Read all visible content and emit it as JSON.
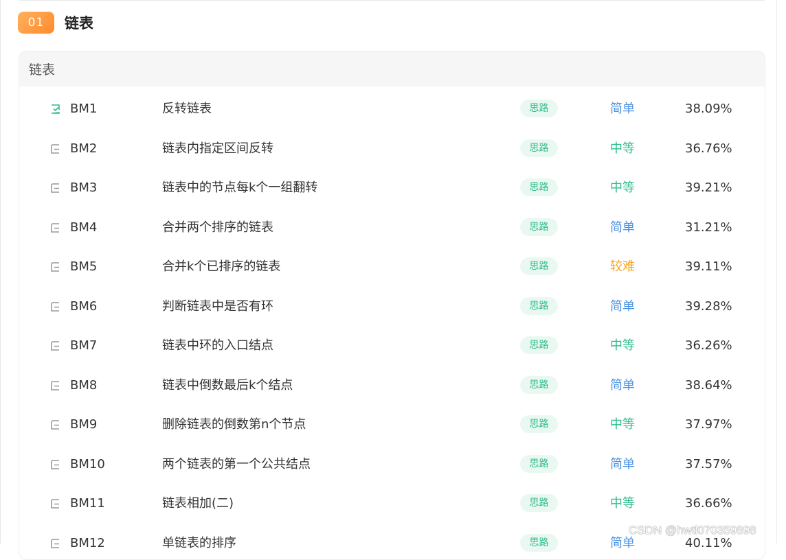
{
  "chapter": {
    "number": "01",
    "title": "链表"
  },
  "section": {
    "title": "链表"
  },
  "colors": {
    "accent_orange": "#ff9a3c",
    "easy": "#4a90e2",
    "medium": "#2fbd8b",
    "hard": "#f5a623",
    "tag_bg": "#eaf8f2",
    "tag_text": "#2fbd8b"
  },
  "problems": [
    {
      "id": "BM1",
      "title": "反转链表",
      "tag": "思路",
      "difficulty": "简单",
      "level": "easy",
      "pass_rate": "38.09%",
      "icon": "solved-check-icon"
    },
    {
      "id": "BM2",
      "title": "链表内指定区间反转",
      "tag": "思路",
      "difficulty": "中等",
      "level": "medium",
      "pass_rate": "36.76%",
      "icon": "unsolved-doc-icon"
    },
    {
      "id": "BM3",
      "title": "链表中的节点每k个一组翻转",
      "tag": "思路",
      "difficulty": "中等",
      "level": "medium",
      "pass_rate": "39.21%",
      "icon": "unsolved-doc-icon"
    },
    {
      "id": "BM4",
      "title": "合并两个排序的链表",
      "tag": "思路",
      "difficulty": "简单",
      "level": "easy",
      "pass_rate": "31.21%",
      "icon": "unsolved-doc-icon"
    },
    {
      "id": "BM5",
      "title": "合并k个已排序的链表",
      "tag": "思路",
      "difficulty": "较难",
      "level": "hard",
      "pass_rate": "39.11%",
      "icon": "unsolved-doc-icon"
    },
    {
      "id": "BM6",
      "title": "判断链表中是否有环",
      "tag": "思路",
      "difficulty": "简单",
      "level": "easy",
      "pass_rate": "39.28%",
      "icon": "unsolved-doc-icon"
    },
    {
      "id": "BM7",
      "title": "链表中环的入口结点",
      "tag": "思路",
      "difficulty": "中等",
      "level": "medium",
      "pass_rate": "36.26%",
      "icon": "unsolved-doc-icon"
    },
    {
      "id": "BM8",
      "title": "链表中倒数最后k个结点",
      "tag": "思路",
      "difficulty": "简单",
      "level": "easy",
      "pass_rate": "38.64%",
      "icon": "unsolved-doc-icon"
    },
    {
      "id": "BM9",
      "title": "删除链表的倒数第n个节点",
      "tag": "思路",
      "difficulty": "中等",
      "level": "medium",
      "pass_rate": "37.97%",
      "icon": "unsolved-doc-icon"
    },
    {
      "id": "BM10",
      "title": "两个链表的第一个公共结点",
      "tag": "思路",
      "difficulty": "简单",
      "level": "easy",
      "pass_rate": "37.57%",
      "icon": "unsolved-doc-icon"
    },
    {
      "id": "BM11",
      "title": "链表相加(二)",
      "tag": "思路",
      "difficulty": "中等",
      "level": "medium",
      "pass_rate": "36.66%",
      "icon": "unsolved-doc-icon"
    },
    {
      "id": "BM12",
      "title": "单链表的排序",
      "tag": "思路",
      "difficulty": "简单",
      "level": "easy",
      "pass_rate": "40.11%",
      "icon": "unsolved-doc-icon"
    }
  ],
  "watermark": "CSDN @hwtl070359898"
}
